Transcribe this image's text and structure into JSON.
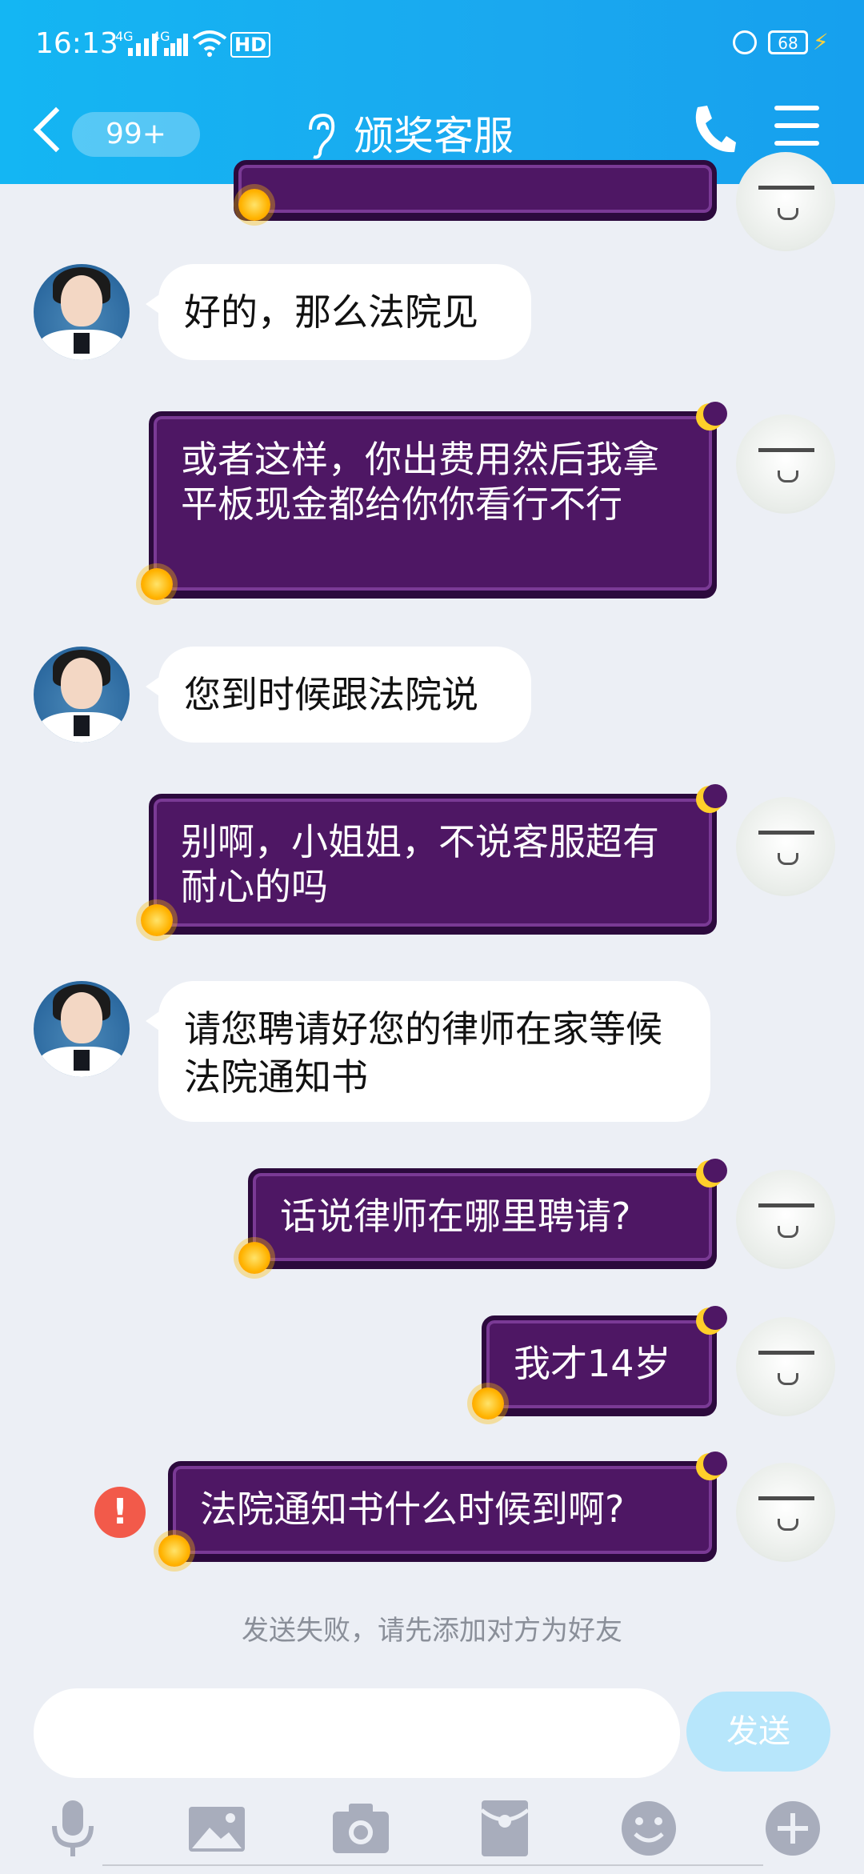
{
  "status_bar": {
    "time": "16:13",
    "net1": "4G",
    "net2": "4G",
    "hd": "HD",
    "battery": "68"
  },
  "header": {
    "back_badge": "99+",
    "title": "颁奖客服"
  },
  "messages": [
    {
      "side": "left",
      "text": "好的，那么法院见"
    },
    {
      "side": "right",
      "text": "或者这样，你出费用然后我拿平板现金都给你你看行不行"
    },
    {
      "side": "left",
      "text": "您到时候跟法院说"
    },
    {
      "side": "right",
      "text": "别啊，小姐姐，不说客服超有耐心的吗"
    },
    {
      "side": "left",
      "text": "请您聘请好您的律师在家等候法院通知书"
    },
    {
      "side": "right",
      "text": "话说律师在哪里聘请?"
    },
    {
      "side": "right",
      "text": "我才14岁"
    },
    {
      "side": "right",
      "text": "法院通知书什么时候到啊?",
      "failed": true
    }
  ],
  "error_mark": "!",
  "system_notice": "发送失败，请先添加对方为好友",
  "input": {
    "placeholder": "",
    "send_label": "发送"
  },
  "toolbar": [
    "microphone-icon",
    "image-icon",
    "camera-icon",
    "red-packet-icon",
    "emoji-icon",
    "plus-icon"
  ],
  "colors": {
    "header": "#16a8ef",
    "self_bubble": "#4e1764",
    "send_button": "#b7e6fb",
    "error": "#f25a4a"
  }
}
